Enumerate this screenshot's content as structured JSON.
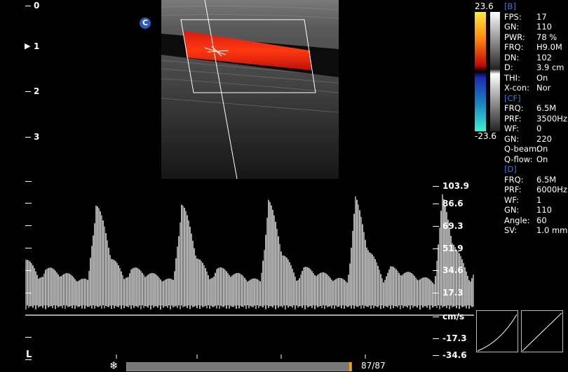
{
  "depth_scale": {
    "labels": [
      "0",
      "1",
      "2",
      "3"
    ],
    "focus_marker": "▶"
  },
  "cursor_badge": "C",
  "color_bar": {
    "max": "23.6",
    "min": "-23.6"
  },
  "params": {
    "b_header": "[B]",
    "b": [
      {
        "k": "FPS:",
        "v": "17"
      },
      {
        "k": "GN:",
        "v": "110"
      },
      {
        "k": "PWR:",
        "v": "78 %"
      },
      {
        "k": "FRQ:",
        "v": "H9.0M"
      },
      {
        "k": "DN:",
        "v": "102"
      },
      {
        "k": "D:",
        "v": "3.9 cm"
      },
      {
        "k": "THI:",
        "v": "On"
      },
      {
        "k": "X-con:",
        "v": "Nor"
      }
    ],
    "cf_header": "[CF]",
    "cf": [
      {
        "k": "FRQ:",
        "v": "6.5M"
      },
      {
        "k": "PRF:",
        "v": "3500Hz"
      },
      {
        "k": "WF:",
        "v": "0"
      },
      {
        "k": "GN:",
        "v": "220"
      },
      {
        "k": "Q-beam:",
        "v": "On"
      },
      {
        "k": "Q-flow:",
        "v": "On"
      }
    ],
    "d_header": "[D]",
    "d": [
      {
        "k": "FRQ:",
        "v": "6.5M"
      },
      {
        "k": "PRF:",
        "v": "6000Hz"
      },
      {
        "k": "WF:",
        "v": "1"
      },
      {
        "k": "GN:",
        "v": "110"
      },
      {
        "k": "Angle:",
        "v": "60"
      },
      {
        "k": "SV:",
        "v": "1.0 mm"
      }
    ]
  },
  "velocity_scale": {
    "labels": [
      "103.9",
      "86.6",
      "69.3",
      "51.9",
      "34.6",
      "17.3",
      "cm/s",
      "-17.3",
      "-34.6"
    ]
  },
  "cine": {
    "counter": "87/87",
    "progress": 1.0,
    "freeze_icon": "snowflake-icon"
  },
  "corner_marker": "L",
  "colors": {
    "accent_orange": "#f0a020",
    "param_header_blue": "#3a78d0"
  }
}
